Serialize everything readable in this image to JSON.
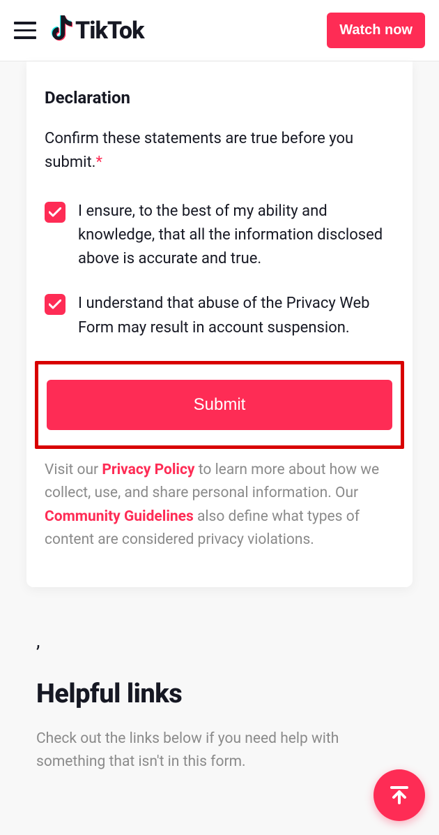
{
  "header": {
    "logo_text": "TikTok",
    "watch_label": "Watch now"
  },
  "declaration": {
    "title": "Declaration",
    "desc": "Confirm these statements are true before you submit.",
    "required_mark": "*",
    "items": [
      {
        "label": "I ensure, to the best of my ability and knowledge, that all the information disclosed above is accurate and true.",
        "checked": true
      },
      {
        "label": "I understand that abuse of the Privacy Web Form may result in account suspension.",
        "checked": true
      }
    ],
    "submit_label": "Submit",
    "note_pre": "Visit our ",
    "privacy_link": "Privacy Policy",
    "note_mid": " to learn more about how we collect, use, and share personal information. Our ",
    "guidelines_link": "Community Guidelines",
    "note_post": " also define what types of content are considered privacy violations."
  },
  "helpful": {
    "stray": ",",
    "title": "Helpful links",
    "desc": "Check out the links below if you need help with something that isn't in this form."
  }
}
